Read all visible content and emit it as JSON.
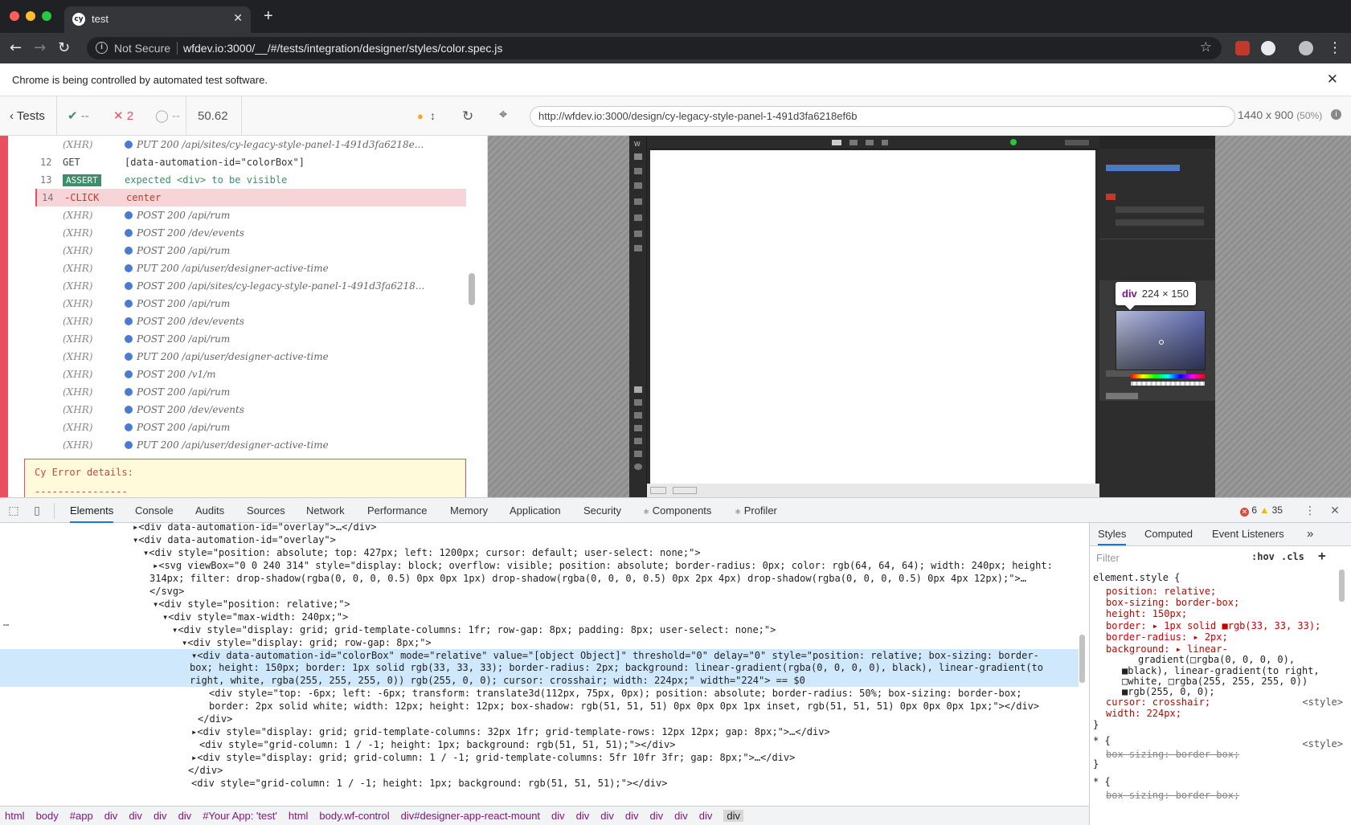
{
  "browser": {
    "tab_title": "test",
    "tab_favicon": "cy",
    "url_security": "Not Secure",
    "url": "wfdev.io:3000/__/#/tests/integration/designer/styles/color.spec.js",
    "banner": "Chrome is being controlled by automated test software."
  },
  "reporter": {
    "back_label": "Tests",
    "passed": "--",
    "failed": "2",
    "pending": "--",
    "duration": "50.62",
    "commands": [
      {
        "num": "",
        "name": "(XHR)",
        "type": "xhr",
        "msg": "PUT 200 /api/sites/cy-legacy-style-panel-1-491d3fa6218e..."
      },
      {
        "num": "12",
        "name": "GET",
        "type": "plain",
        "msg": "[data-automation-id=\"colorBox\"]"
      },
      {
        "num": "13",
        "name": "ASSERT",
        "type": "assert",
        "msg": "expected <div> to be visible"
      },
      {
        "num": "14",
        "name": "-CLICK",
        "type": "click",
        "msg": "center"
      },
      {
        "num": "",
        "name": "(XHR)",
        "type": "xhr",
        "msg": "POST 200 /api/rum"
      },
      {
        "num": "",
        "name": "(XHR)",
        "type": "xhr",
        "msg": "POST 200 /dev/events"
      },
      {
        "num": "",
        "name": "(XHR)",
        "type": "xhr",
        "msg": "POST 200 /api/rum"
      },
      {
        "num": "",
        "name": "(XHR)",
        "type": "xhr",
        "msg": "PUT 200 /api/user/designer-active-time"
      },
      {
        "num": "",
        "name": "(XHR)",
        "type": "xhr",
        "msg": "POST 200 /api/sites/cy-legacy-style-panel-1-491d3fa6218..."
      },
      {
        "num": "",
        "name": "(XHR)",
        "type": "xhr",
        "msg": "POST 200 /api/rum"
      },
      {
        "num": "",
        "name": "(XHR)",
        "type": "xhr",
        "msg": "POST 200 /dev/events"
      },
      {
        "num": "",
        "name": "(XHR)",
        "type": "xhr",
        "msg": "POST 200 /api/rum"
      },
      {
        "num": "",
        "name": "(XHR)",
        "type": "xhr",
        "msg": "PUT 200 /api/user/designer-active-time"
      },
      {
        "num": "",
        "name": "(XHR)",
        "type": "xhr",
        "msg": "POST 200 /v1/m"
      },
      {
        "num": "",
        "name": "(XHR)",
        "type": "xhr",
        "msg": "POST 200 /api/rum"
      },
      {
        "num": "",
        "name": "(XHR)",
        "type": "xhr",
        "msg": "POST 200 /dev/events"
      },
      {
        "num": "",
        "name": "(XHR)",
        "type": "xhr",
        "msg": "POST 200 /api/rum"
      },
      {
        "num": "",
        "name": "(XHR)",
        "type": "xhr",
        "msg": "PUT 200 /api/user/designer-active-time"
      }
    ],
    "error_title": "Cy Error details:",
    "error_rule": "----------------"
  },
  "aut": {
    "url": "http://wfdev.io:3000/design/cy-legacy-style-panel-1-491d3fa6218ef6b",
    "size": "1440 x 900",
    "scale": "(50%)",
    "tooltip_tag": "div",
    "tooltip_dims": "224 × 150"
  },
  "devtools": {
    "tabs": [
      "Elements",
      "Console",
      "Audits",
      "Sources",
      "Network",
      "Performance",
      "Memory",
      "Application",
      "Security",
      "Components",
      "Profiler"
    ],
    "errors": "6",
    "warnings": "35",
    "dom_lines": [
      "▸<div data-automation-id=\"overlay\">…</div>",
      "▾<div data-automation-id=\"overlay\">",
      "▾<div style=\"position: absolute; top: 427px; left: 1200px; cursor: default; user-select: none;\">",
      "▸<svg viewBox=\"0 0 240 314\" style=\"display: block; overflow: visible; position: absolute; border-radius: 0px; color: rgb(64, 64, 64); width: 240px; height:",
      "314px; filter: drop-shadow(rgba(0, 0, 0, 0.5) 0px 0px 1px) drop-shadow(rgba(0, 0, 0, 0.5) 0px 2px 4px) drop-shadow(rgba(0, 0, 0, 0.5) 0px 4px 12px);\">…",
      "</svg>",
      "▾<div style=\"position: relative;\">",
      "▾<div style=\"max-width: 240px;\">",
      "▾<div style=\"display: grid; grid-template-columns: 1fr; row-gap: 8px; padding: 8px; user-select: none;\">",
      "▾<div style=\"display: grid; row-gap: 8px;\">",
      "▾<div data-automation-id=\"colorBox\" mode=\"relative\" value=\"[object Object]\" threshold=\"0\" delay=\"0\" style=\"position: relative; box-sizing: border-",
      "box; height: 150px; border: 1px solid rgb(33, 33, 33); border-radius: 2px; background: linear-gradient(rgba(0, 0, 0, 0), black), linear-gradient(to",
      "right, white, rgba(255, 255, 255, 0)) rgb(255, 0, 0); cursor: crosshair; width: 224px;\" width=\"224\"> == $0",
      "<div style=\"top: -6px; left: -6px; transform: translate3d(112px, 75px, 0px); position: absolute; border-radius: 50%; box-sizing: border-box;",
      "border: 2px solid white; width: 12px; height: 12px; box-shadow: rgb(51, 51, 51) 0px 0px 0px 1px inset, rgb(51, 51, 51) 0px 0px 0px 1px;\"></div>",
      "</div>",
      "▸<div style=\"display: grid; grid-template-columns: 32px 1fr; grid-template-rows: 12px 12px; gap: 8px;\">…</div>",
      "<div style=\"grid-column: 1 / -1; height: 1px; background: rgb(51, 51, 51);\"></div>",
      "▸<div style=\"display: grid; grid-column: 1 / -1; grid-template-columns: 5fr 10fr 3fr; gap: 8px;\">…</div>",
      "</div>",
      "<div style=\"grid-column: 1 / -1; height: 1px; background: rgb(51, 51, 51);\"></div>"
    ],
    "styles_tabs": [
      "Styles",
      "Computed",
      "Event Listeners"
    ],
    "filter_placeholder": "Filter",
    "hov": ":hov",
    "cls": ".cls",
    "style_lines": [
      "element.style {",
      "position: relative;",
      "box-sizing: border-box;",
      "height: 150px;",
      "border: ▸ 1px solid ■rgb(33, 33, 33);",
      "border-radius: ▸ 2px;",
      "background: ▸ linear-",
      "gradient(□rgba(0, 0, 0, 0),",
      "■black), linear-gradient(to right,",
      "□white, □rgba(255, 255, 255, 0))",
      "■rgb(255, 0, 0);",
      "cursor: crosshair;",
      "width: 224px;",
      "}",
      "* {",
      "box-sizing: border-box;",
      "}",
      "* {",
      "box-sizing: border-box;"
    ],
    "style_source": "<style>",
    "breadcrumbs": [
      "html",
      "body",
      "#app",
      "div",
      "div",
      "div",
      "div",
      "#Your App: 'test'",
      "html",
      "body.wf-control",
      "div#designer-app-react-mount",
      "div",
      "div",
      "div",
      "div",
      "div",
      "div",
      "div",
      "div"
    ]
  }
}
